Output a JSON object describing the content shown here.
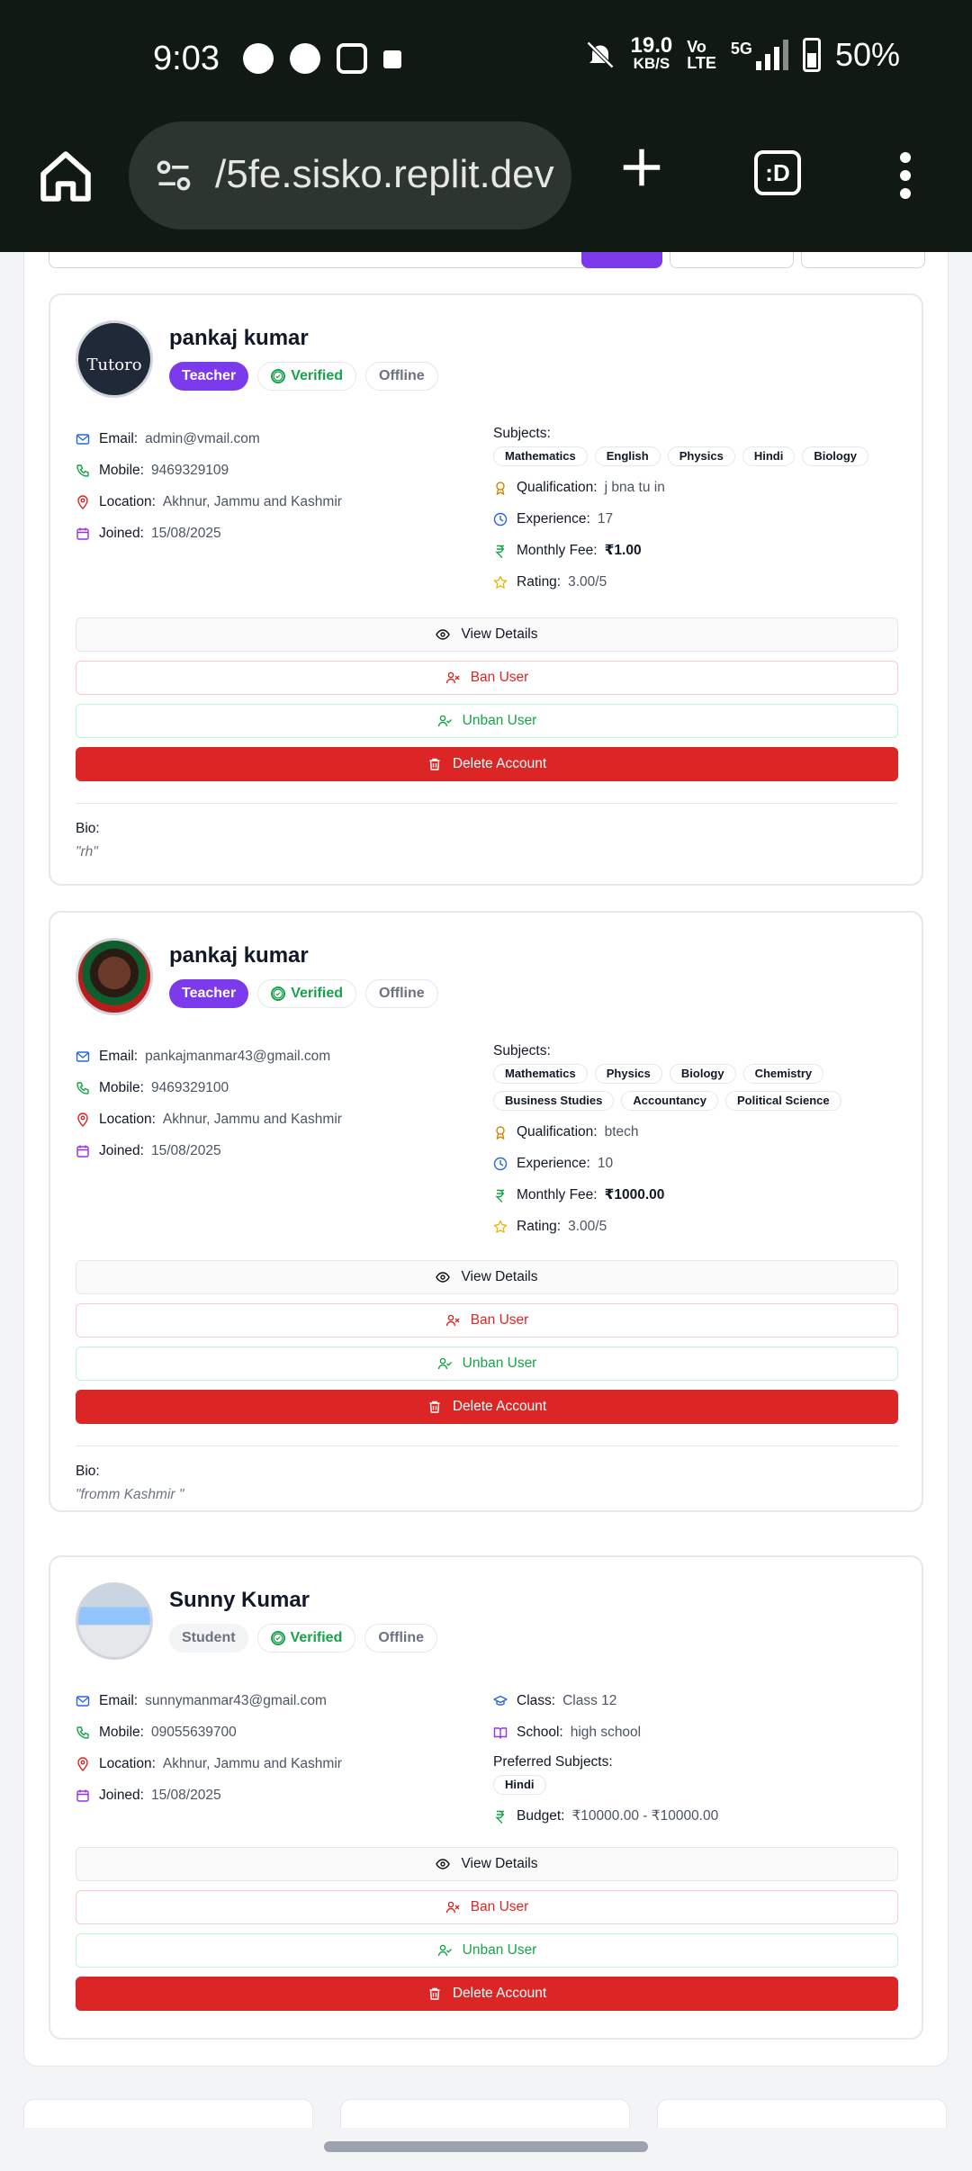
{
  "status_bar": {
    "time": "9:03",
    "speed_value": "19.0",
    "speed_unit": "KB/S",
    "volte_1": "Vo",
    "volte_2": "LTE",
    "network": "5G",
    "battery": "50%"
  },
  "browser": {
    "url": "/5fe.sisko.replit.dev",
    "tabs_label": ":D"
  },
  "cards": [
    {
      "name": "pankaj kumar",
      "role": "Teacher",
      "verified": "Verified",
      "presence": "Offline",
      "avatar_text": "Tutoro",
      "email_label": "Email:",
      "email": "admin@vmail.com",
      "mobile_label": "Mobile:",
      "mobile": "9469329109",
      "location_label": "Location:",
      "location": "Akhnur, Jammu and Kashmir",
      "joined_label": "Joined:",
      "joined": "15/08/2025",
      "subjects_label": "Subjects:",
      "subjects": [
        "Mathematics",
        "English",
        "Physics",
        "Hindi",
        "Biology"
      ],
      "qualification_label": "Qualification:",
      "qualification": "j bna tu in",
      "experience_label": "Experience:",
      "experience": "17",
      "fee_label": "Monthly Fee:",
      "fee": "₹1.00",
      "rating_label": "Rating:",
      "rating": "3.00/5",
      "bio_label": "Bio:",
      "bio": "\"rh\""
    },
    {
      "name": "pankaj kumar",
      "role": "Teacher",
      "verified": "Verified",
      "presence": "Offline",
      "email_label": "Email:",
      "email": "pankajmanmar43@gmail.com",
      "mobile_label": "Mobile:",
      "mobile": "9469329100",
      "location_label": "Location:",
      "location": "Akhnur, Jammu and Kashmir",
      "joined_label": "Joined:",
      "joined": "15/08/2025",
      "subjects_label": "Subjects:",
      "subjects": [
        "Mathematics",
        "Physics",
        "Biology",
        "Chemistry",
        "Business Studies",
        "Accountancy",
        "Political Science"
      ],
      "qualification_label": "Qualification:",
      "qualification": "btech",
      "experience_label": "Experience:",
      "experience": "10",
      "fee_label": "Monthly Fee:",
      "fee": "₹1000.00",
      "rating_label": "Rating:",
      "rating": "3.00/5",
      "bio_label": "Bio:",
      "bio": "\"fromm Kashmir \""
    },
    {
      "name": "Sunny Kumar",
      "role": "Student",
      "verified": "Verified",
      "presence": "Offline",
      "email_label": "Email:",
      "email": "sunnymanmar43@gmail.com",
      "mobile_label": "Mobile:",
      "mobile": "09055639700",
      "location_label": "Location:",
      "location": "Akhnur, Jammu and Kashmir",
      "joined_label": "Joined:",
      "joined": "15/08/2025",
      "class_label": "Class:",
      "class": "Class 12",
      "school_label": "School:",
      "school": "high school",
      "pref_subjects_label": "Preferred Subjects:",
      "pref_subjects": [
        "Hindi"
      ],
      "budget_label": "Budget:",
      "budget": "₹10000.00 - ₹10000.00"
    }
  ],
  "actions": {
    "view": "View Details",
    "ban": "Ban User",
    "unban": "Unban User",
    "delete": "Delete Account"
  },
  "colors": {
    "accent": "#7c3aed",
    "danger": "#dc2626",
    "success": "#16a34a",
    "chrome": "#101a12"
  }
}
